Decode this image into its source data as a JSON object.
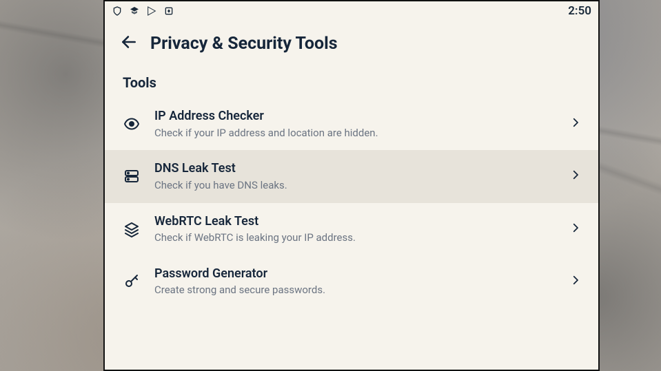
{
  "statusbar": {
    "clock": "2:50",
    "icons": [
      "mcafee-icon",
      "fsecure-icon",
      "play-store-icon",
      "app-box-icon"
    ]
  },
  "header": {
    "title": "Privacy & Security Tools"
  },
  "section": {
    "title": "Tools"
  },
  "tools": [
    {
      "icon": "eye-icon",
      "title": "IP Address Checker",
      "desc": "Check if your IP address and location are hidden.",
      "highlight": false
    },
    {
      "icon": "server-icon",
      "title": "DNS Leak Test",
      "desc": "Check if you have DNS leaks.",
      "highlight": true
    },
    {
      "icon": "layers-icon",
      "title": "WebRTC Leak Test",
      "desc": "Check if WebRTC is leaking your IP address.",
      "highlight": false
    },
    {
      "icon": "key-icon",
      "title": "Password Generator",
      "desc": "Create strong and secure passwords.",
      "highlight": false
    }
  ]
}
